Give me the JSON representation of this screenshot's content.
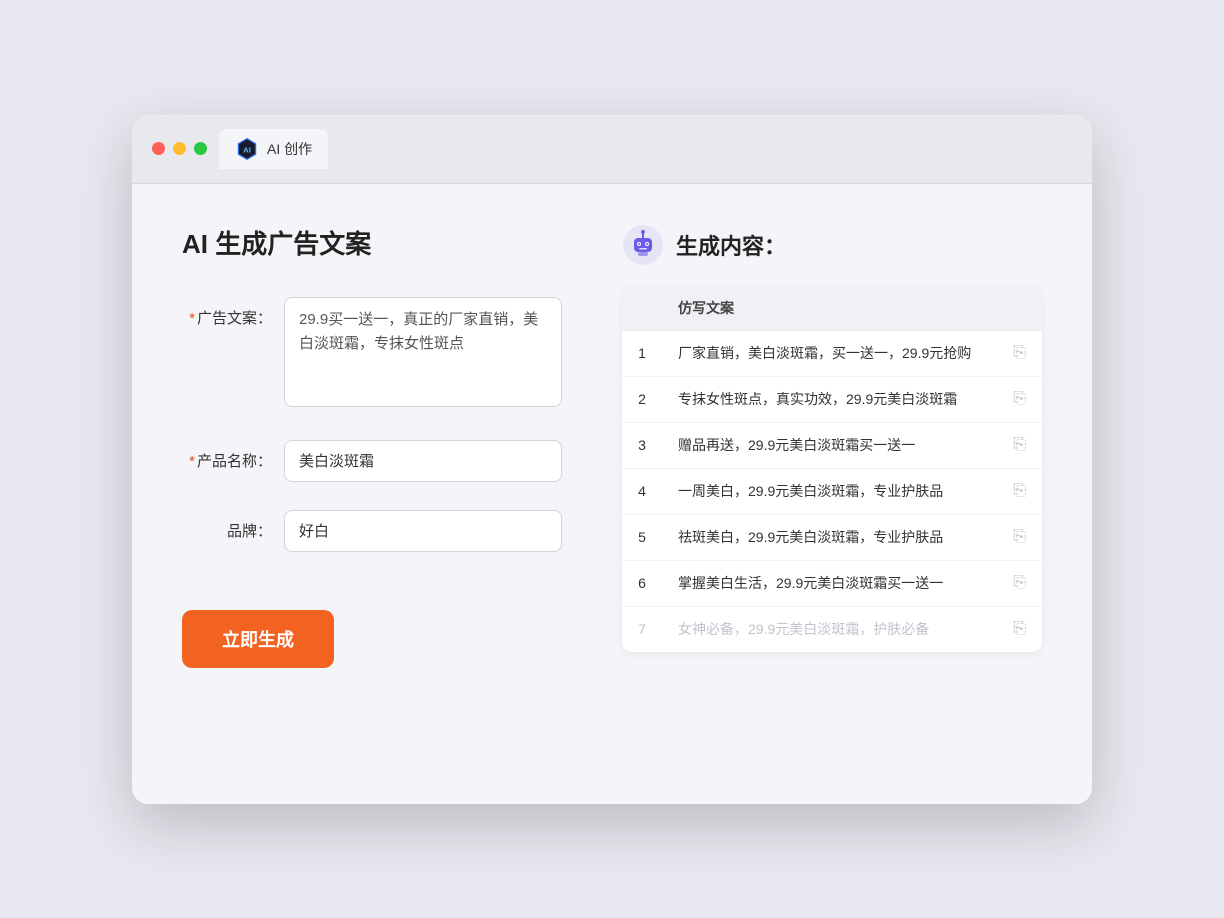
{
  "browser": {
    "tab_label": "AI 创作"
  },
  "left": {
    "title": "AI 生成广告文案",
    "fields": [
      {
        "label": "广告文案：",
        "required": true,
        "type": "textarea",
        "value": "29.9买一送一，真正的厂家直销，美白淡斑霜，专抹女性斑点"
      },
      {
        "label": "产品名称：",
        "required": true,
        "type": "input",
        "value": "美白淡斑霜"
      },
      {
        "label": "品牌：",
        "required": false,
        "type": "input",
        "value": "好白"
      }
    ],
    "generate_btn": "立即生成"
  },
  "right": {
    "title": "生成内容：",
    "table_header": "仿写文案",
    "results": [
      {
        "num": "1",
        "text": "厂家直销，美白淡斑霜，买一送一，29.9元抢购",
        "faded": false
      },
      {
        "num": "2",
        "text": "专抹女性斑点，真实功效，29.9元美白淡斑霜",
        "faded": false
      },
      {
        "num": "3",
        "text": "赠品再送，29.9元美白淡斑霜买一送一",
        "faded": false
      },
      {
        "num": "4",
        "text": "一周美白，29.9元美白淡斑霜，专业护肤品",
        "faded": false
      },
      {
        "num": "5",
        "text": "祛斑美白，29.9元美白淡斑霜，专业护肤品",
        "faded": false
      },
      {
        "num": "6",
        "text": "掌握美白生活，29.9元美白淡斑霜买一送一",
        "faded": false
      },
      {
        "num": "7",
        "text": "女神必备，29.9元美白淡斑霜，护肤必备",
        "faded": true
      }
    ]
  }
}
